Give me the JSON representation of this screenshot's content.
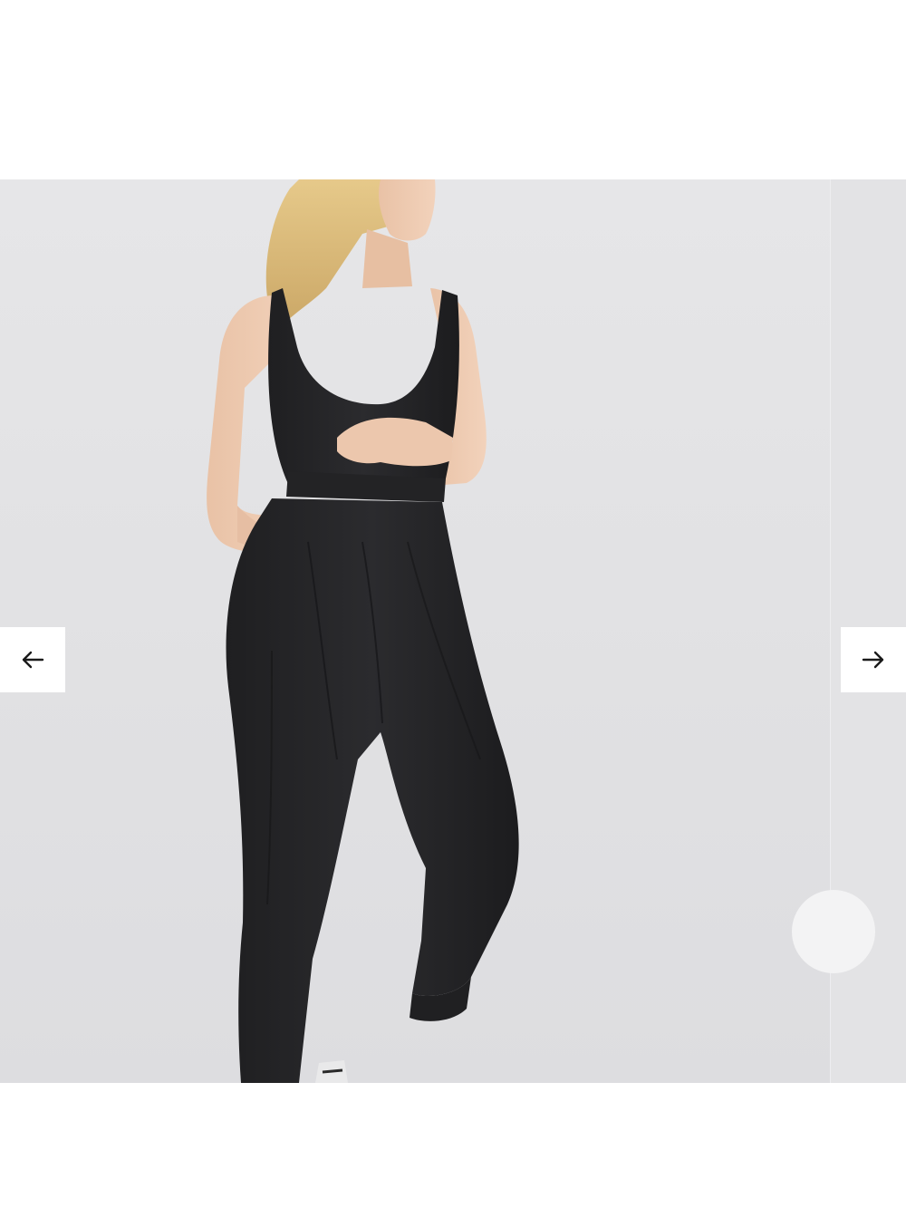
{
  "gallery": {
    "image_description_name": "product-photo",
    "prev_icon": "arrow-left-icon",
    "next_icon": "arrow-right-icon",
    "zoom_icon": "zoom-button",
    "colors": {
      "backdrop": "#e3e3e5",
      "garment": "#262628",
      "nav_button_bg": "#ffffff",
      "arrow": "#1a1a1a"
    }
  }
}
